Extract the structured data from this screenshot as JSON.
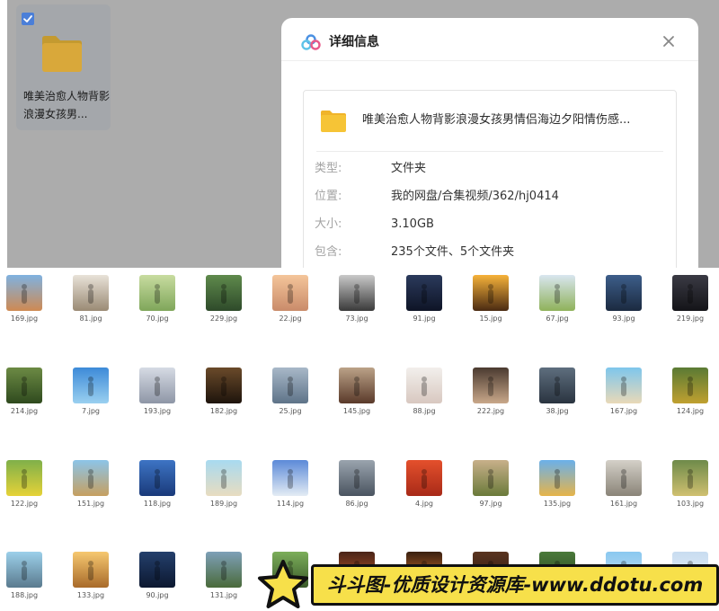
{
  "folder_card": {
    "name": "唯美治愈人物背影浪漫女孩男..."
  },
  "dialog": {
    "title": "详细信息",
    "folder_name": "唯美治愈人物背影浪漫女孩男情侣海边夕阳情伤感...",
    "rows": [
      {
        "label": "类型:",
        "value": "文件夹"
      },
      {
        "label": "位置:",
        "value": "我的网盘/合集视频/362/hj0414"
      },
      {
        "label": "大小:",
        "value": "3.10GB"
      },
      {
        "label": "包含:",
        "value": "235个文件、5个文件夹"
      }
    ]
  },
  "thumbnails": [
    {
      "label": "169.jpg",
      "top": "#7fb2e0",
      "bottom": "#cf8a52"
    },
    {
      "label": "81.jpg",
      "top": "#e8e2d8",
      "bottom": "#9a8a74"
    },
    {
      "label": "70.jpg",
      "top": "#c8dca0",
      "bottom": "#7fa65a"
    },
    {
      "label": "229.jpg",
      "top": "#5f8a4c",
      "bottom": "#2e4a2a"
    },
    {
      "label": "22.jpg",
      "top": "#f4c59a",
      "bottom": "#c98b6a"
    },
    {
      "label": "73.jpg",
      "top": "#c9c9c9",
      "bottom": "#3a3a3a"
    },
    {
      "label": "91.jpg",
      "top": "#2b3a5c",
      "bottom": "#0e1426"
    },
    {
      "label": "15.jpg",
      "top": "#f6b23a",
      "bottom": "#4a2a12"
    },
    {
      "label": "67.jpg",
      "top": "#d9e6f0",
      "bottom": "#8fb25a"
    },
    {
      "label": "93.jpg",
      "top": "#3d5e8a",
      "bottom": "#1b2a40"
    },
    {
      "label": "219.jpg",
      "top": "#3a3a44",
      "bottom": "#141418"
    },
    {
      "label": "214.jpg",
      "top": "#6c8a44",
      "bottom": "#2f4a1e"
    },
    {
      "label": "7.jpg",
      "top": "#3d8ad8",
      "bottom": "#9ad0f0"
    },
    {
      "label": "193.jpg",
      "top": "#d6dbe4",
      "bottom": "#8e96a6"
    },
    {
      "label": "182.jpg",
      "top": "#6a4a2a",
      "bottom": "#1e140c"
    },
    {
      "label": "25.jpg",
      "top": "#a8b8c8",
      "bottom": "#5e7388"
    },
    {
      "label": "145.jpg",
      "top": "#bba288",
      "bottom": "#5a3a2a"
    },
    {
      "label": "88.jpg",
      "top": "#f2efec",
      "bottom": "#d8c8c0"
    },
    {
      "label": "222.jpg",
      "top": "#4a3a30",
      "bottom": "#c9a88a"
    },
    {
      "label": "38.jpg",
      "top": "#5e6e7e",
      "bottom": "#2a3440"
    },
    {
      "label": "167.jpg",
      "top": "#7ec6ec",
      "bottom": "#e9d9b8"
    },
    {
      "label": "124.jpg",
      "top": "#5a7a34",
      "bottom": "#c0a030"
    },
    {
      "label": "122.jpg",
      "top": "#7fb04a",
      "bottom": "#e6d238"
    },
    {
      "label": "151.jpg",
      "top": "#8cc4e8",
      "bottom": "#c6a060"
    },
    {
      "label": "118.jpg",
      "top": "#3d74c4",
      "bottom": "#1a3a7a"
    },
    {
      "label": "189.jpg",
      "top": "#a8daf0",
      "bottom": "#e8dcc0"
    },
    {
      "label": "114.jpg",
      "top": "#5c8ad8",
      "bottom": "#e4ecf4"
    },
    {
      "label": "86.jpg",
      "top": "#9aa4ae",
      "bottom": "#4a5460"
    },
    {
      "label": "4.jpg",
      "top": "#e4502c",
      "bottom": "#a82a18"
    },
    {
      "label": "97.jpg",
      "top": "#c8b08a",
      "bottom": "#6a7a3a"
    },
    {
      "label": "135.jpg",
      "top": "#6ab0ea",
      "bottom": "#e6b44a"
    },
    {
      "label": "161.jpg",
      "top": "#d4d0c8",
      "bottom": "#8a8478"
    },
    {
      "label": "103.jpg",
      "top": "#6e8a4a",
      "bottom": "#d0c070"
    },
    {
      "label": "188.jpg",
      "top": "#9cd0ea",
      "bottom": "#5a7a8e"
    },
    {
      "label": "133.jpg",
      "top": "#f6c870",
      "bottom": "#a86a2a"
    },
    {
      "label": "90.jpg",
      "top": "#24406c",
      "bottom": "#0c1830"
    },
    {
      "label": "131.jpg",
      "top": "#7ea0b8",
      "bottom": "#4a6a3a"
    },
    {
      "label": "",
      "top": "#7cae5a",
      "bottom": "#3a5a2a"
    },
    {
      "label": "",
      "top": "#4a2418",
      "bottom": "#c45a2a"
    },
    {
      "label": "",
      "top": "#3a2010",
      "bottom": "#e07a30"
    },
    {
      "label": "",
      "top": "#5a3420",
      "bottom": "#2a1810"
    },
    {
      "label": "",
      "top": "#4a7a3a",
      "bottom": "#2a4020"
    },
    {
      "label": "",
      "top": "#8ac8f0",
      "bottom": "#c8e0f0"
    },
    {
      "label": "",
      "top": "#c8dcf0",
      "bottom": "#e8f0f8"
    }
  ],
  "banner": {
    "text": "斗斗图-优质设计资源库-www.ddotu.com"
  },
  "colors": {
    "overlay": "#acacac",
    "folder_yellow": "#f6c436",
    "checkbox_blue": "#4b7fd8",
    "banner_yellow": "#f7e04a"
  },
  "icons": {
    "checkbox": "checkbox-checked-icon",
    "folder": "folder-icon",
    "logo": "cloud-drive-logo-icon",
    "close": "close-icon",
    "star": "star-icon"
  }
}
